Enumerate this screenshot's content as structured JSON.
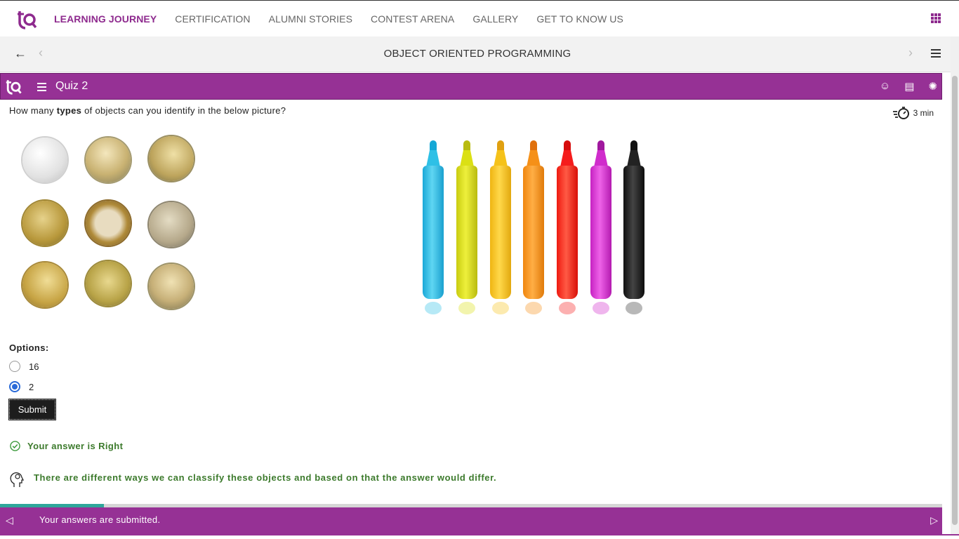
{
  "nav": {
    "items": [
      "LEARNING JOURNEY",
      "CERTIFICATION",
      "ALUMNI STORIES",
      "CONTEST ARENA",
      "GALLERY",
      "GET TO KNOW US"
    ],
    "active_color": "#8e2a8e"
  },
  "course": {
    "title": "OBJECT ORIENTED PROGRAMMING"
  },
  "quiz": {
    "title": "Quiz 2",
    "timer": "3 min",
    "question_pre": "How many ",
    "question_bold": "types",
    "question_post": " of objects can you identify in the below picture?",
    "options_label": "Options:",
    "options": [
      {
        "label": "16",
        "selected": false
      },
      {
        "label": "2",
        "selected": true
      }
    ],
    "submit_label": "Submit",
    "result": "Your answer is Right",
    "explanation": "There are different ways we can classify these objects and based on that the answer would differ."
  },
  "footer": {
    "message": "Your answers are submitted.",
    "progress": 0.11
  },
  "colors": {
    "brand_purple": "#963195",
    "success_green": "#3c7a2c",
    "progress_teal": "#2fa79a"
  }
}
